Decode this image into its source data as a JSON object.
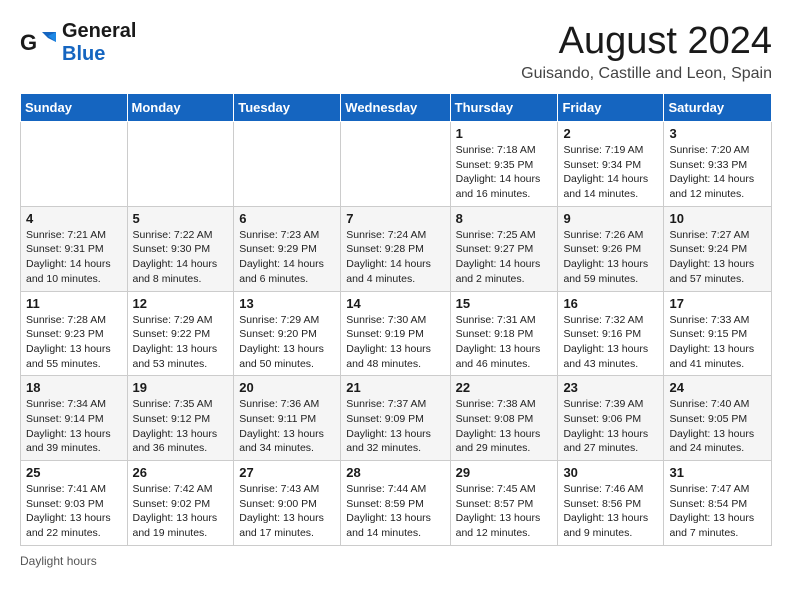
{
  "logo": {
    "line1": "General",
    "line2": "Blue"
  },
  "title": "August 2024",
  "subtitle": "Guisando, Castille and Leon, Spain",
  "weekdays": [
    "Sunday",
    "Monday",
    "Tuesday",
    "Wednesday",
    "Thursday",
    "Friday",
    "Saturday"
  ],
  "weeks": [
    [
      {
        "day": "",
        "info": ""
      },
      {
        "day": "",
        "info": ""
      },
      {
        "day": "",
        "info": ""
      },
      {
        "day": "",
        "info": ""
      },
      {
        "day": "1",
        "info": "Sunrise: 7:18 AM\nSunset: 9:35 PM\nDaylight: 14 hours and 16 minutes."
      },
      {
        "day": "2",
        "info": "Sunrise: 7:19 AM\nSunset: 9:34 PM\nDaylight: 14 hours and 14 minutes."
      },
      {
        "day": "3",
        "info": "Sunrise: 7:20 AM\nSunset: 9:33 PM\nDaylight: 14 hours and 12 minutes."
      }
    ],
    [
      {
        "day": "4",
        "info": "Sunrise: 7:21 AM\nSunset: 9:31 PM\nDaylight: 14 hours and 10 minutes."
      },
      {
        "day": "5",
        "info": "Sunrise: 7:22 AM\nSunset: 9:30 PM\nDaylight: 14 hours and 8 minutes."
      },
      {
        "day": "6",
        "info": "Sunrise: 7:23 AM\nSunset: 9:29 PM\nDaylight: 14 hours and 6 minutes."
      },
      {
        "day": "7",
        "info": "Sunrise: 7:24 AM\nSunset: 9:28 PM\nDaylight: 14 hours and 4 minutes."
      },
      {
        "day": "8",
        "info": "Sunrise: 7:25 AM\nSunset: 9:27 PM\nDaylight: 14 hours and 2 minutes."
      },
      {
        "day": "9",
        "info": "Sunrise: 7:26 AM\nSunset: 9:26 PM\nDaylight: 13 hours and 59 minutes."
      },
      {
        "day": "10",
        "info": "Sunrise: 7:27 AM\nSunset: 9:24 PM\nDaylight: 13 hours and 57 minutes."
      }
    ],
    [
      {
        "day": "11",
        "info": "Sunrise: 7:28 AM\nSunset: 9:23 PM\nDaylight: 13 hours and 55 minutes."
      },
      {
        "day": "12",
        "info": "Sunrise: 7:29 AM\nSunset: 9:22 PM\nDaylight: 13 hours and 53 minutes."
      },
      {
        "day": "13",
        "info": "Sunrise: 7:29 AM\nSunset: 9:20 PM\nDaylight: 13 hours and 50 minutes."
      },
      {
        "day": "14",
        "info": "Sunrise: 7:30 AM\nSunset: 9:19 PM\nDaylight: 13 hours and 48 minutes."
      },
      {
        "day": "15",
        "info": "Sunrise: 7:31 AM\nSunset: 9:18 PM\nDaylight: 13 hours and 46 minutes."
      },
      {
        "day": "16",
        "info": "Sunrise: 7:32 AM\nSunset: 9:16 PM\nDaylight: 13 hours and 43 minutes."
      },
      {
        "day": "17",
        "info": "Sunrise: 7:33 AM\nSunset: 9:15 PM\nDaylight: 13 hours and 41 minutes."
      }
    ],
    [
      {
        "day": "18",
        "info": "Sunrise: 7:34 AM\nSunset: 9:14 PM\nDaylight: 13 hours and 39 minutes."
      },
      {
        "day": "19",
        "info": "Sunrise: 7:35 AM\nSunset: 9:12 PM\nDaylight: 13 hours and 36 minutes."
      },
      {
        "day": "20",
        "info": "Sunrise: 7:36 AM\nSunset: 9:11 PM\nDaylight: 13 hours and 34 minutes."
      },
      {
        "day": "21",
        "info": "Sunrise: 7:37 AM\nSunset: 9:09 PM\nDaylight: 13 hours and 32 minutes."
      },
      {
        "day": "22",
        "info": "Sunrise: 7:38 AM\nSunset: 9:08 PM\nDaylight: 13 hours and 29 minutes."
      },
      {
        "day": "23",
        "info": "Sunrise: 7:39 AM\nSunset: 9:06 PM\nDaylight: 13 hours and 27 minutes."
      },
      {
        "day": "24",
        "info": "Sunrise: 7:40 AM\nSunset: 9:05 PM\nDaylight: 13 hours and 24 minutes."
      }
    ],
    [
      {
        "day": "25",
        "info": "Sunrise: 7:41 AM\nSunset: 9:03 PM\nDaylight: 13 hours and 22 minutes."
      },
      {
        "day": "26",
        "info": "Sunrise: 7:42 AM\nSunset: 9:02 PM\nDaylight: 13 hours and 19 minutes."
      },
      {
        "day": "27",
        "info": "Sunrise: 7:43 AM\nSunset: 9:00 PM\nDaylight: 13 hours and 17 minutes."
      },
      {
        "day": "28",
        "info": "Sunrise: 7:44 AM\nSunset: 8:59 PM\nDaylight: 13 hours and 14 minutes."
      },
      {
        "day": "29",
        "info": "Sunrise: 7:45 AM\nSunset: 8:57 PM\nDaylight: 13 hours and 12 minutes."
      },
      {
        "day": "30",
        "info": "Sunrise: 7:46 AM\nSunset: 8:56 PM\nDaylight: 13 hours and 9 minutes."
      },
      {
        "day": "31",
        "info": "Sunrise: 7:47 AM\nSunset: 8:54 PM\nDaylight: 13 hours and 7 minutes."
      }
    ]
  ],
  "footer": "Daylight hours"
}
